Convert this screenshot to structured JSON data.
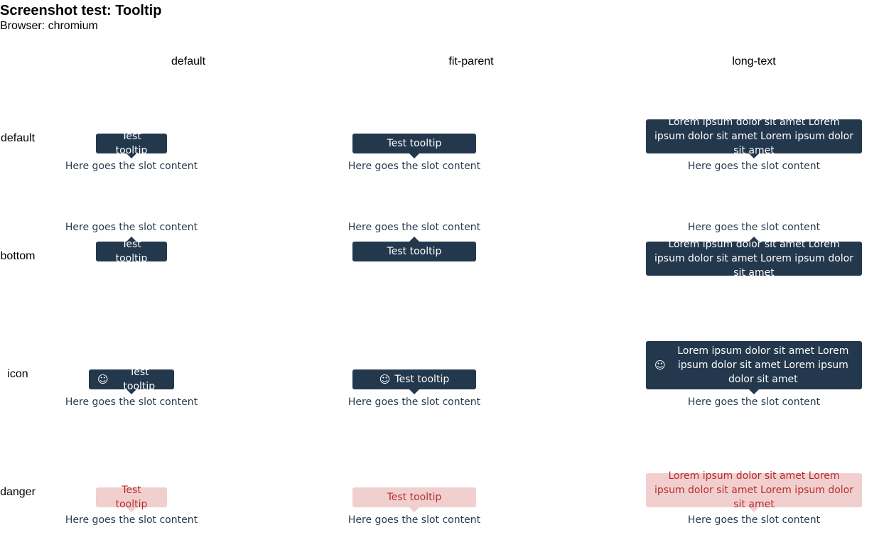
{
  "title": "Screenshot test: Tooltip",
  "browser": "Browser: chromium",
  "columns": [
    "default",
    "fit-parent",
    "long-text"
  ],
  "rows": [
    "default",
    "bottom",
    "icon",
    "danger"
  ],
  "slot": "Here goes the slot content",
  "tooltip_short": "Test tooltip",
  "tooltip_long": "Lorem ipsum dolor sit amet Lorem ipsum dolor sit amet Lorem ipsum dolor sit amet",
  "icon": "smiley-icon",
  "colors": {
    "tooltip_bg": "#23384d",
    "tooltip_text": "#ffffff",
    "danger_bg": "#f2cfcf",
    "danger_text": "#b52d2d",
    "slot_text": "#283a4d"
  }
}
